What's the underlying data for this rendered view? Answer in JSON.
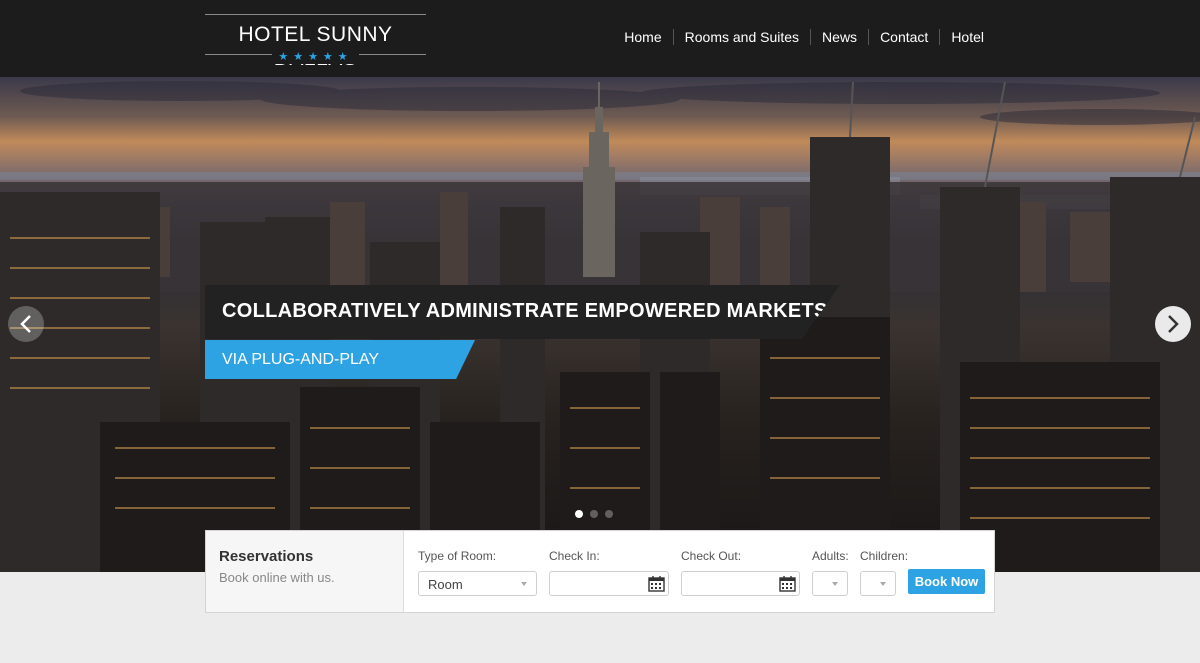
{
  "brand": {
    "name": "HOTEL SUNNY DALLAS",
    "stars": "★★★★★",
    "accent": "#2ea3e3"
  },
  "nav": {
    "items": [
      "Home",
      "Rooms and Suites",
      "News",
      "Contact",
      "Hotel"
    ]
  },
  "hero": {
    "title": "COLLABORATIVELY ADMINISTRATE EMPOWERED MARKETS",
    "subtitle": "VIA PLUG-AND-PLAY",
    "slide_count": 3,
    "active_slide": 1,
    "prev_icon": "chevron-left-icon",
    "next_icon": "chevron-right-icon"
  },
  "reservation": {
    "title": "Reservations",
    "subtitle": "Book online with us.",
    "room_type_label": "Type of Room:",
    "room_type_value": "Room",
    "checkin_label": "Check In:",
    "checkout_label": "Check Out:",
    "adults_label": "Adults:",
    "children_label": "Children:",
    "book_label": "Book Now",
    "calendar_icon": "calendar-icon"
  }
}
